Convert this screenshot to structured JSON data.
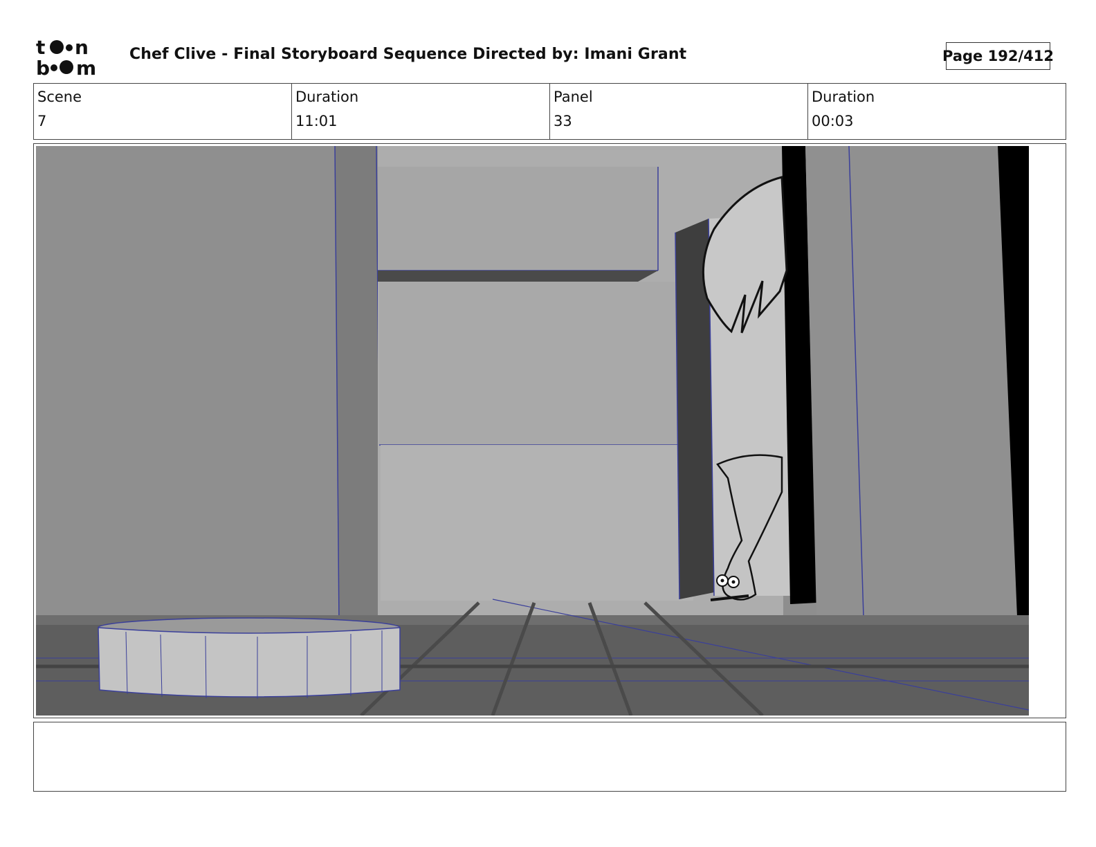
{
  "header": {
    "logo_text": "toonboom",
    "title": "Chef Clive - Final Storyboard Sequence  Directed by: Imani Grant",
    "page": "Page 192/412"
  },
  "info": {
    "scene_label": "Scene",
    "scene_value": "7",
    "scene_duration_label": "Duration",
    "scene_duration_value": "11:01",
    "panel_label": "Panel",
    "panel_value": "33",
    "panel_duration_label": "Duration",
    "panel_duration_value": "00:03"
  },
  "panel": {
    "background_color": "#8e8e8e",
    "wireframe_color": "#3a3f9a"
  },
  "notes": {
    "text": ""
  }
}
